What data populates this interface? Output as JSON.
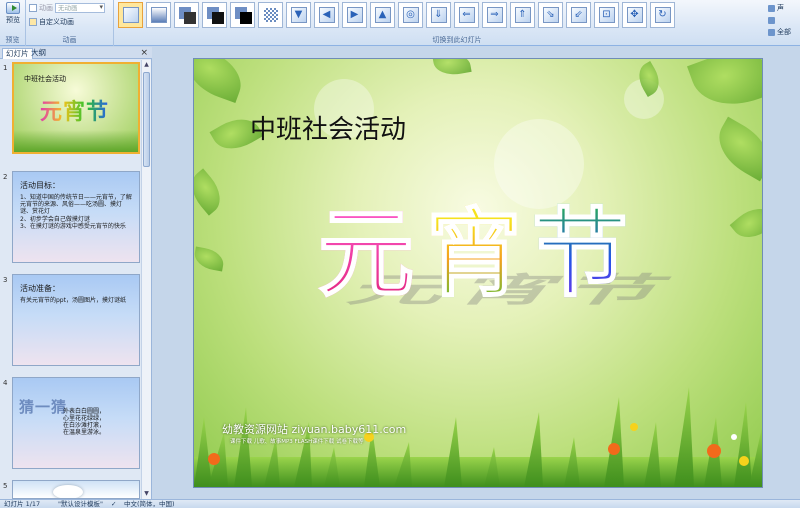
{
  "ribbon": {
    "preview_label": "预览",
    "preview_group": "预览",
    "anim_label": "动画",
    "anim_value": "无动画",
    "custom_anim_label": "自定义动画",
    "anim_group": "动画",
    "transition_group": "切换到此幻灯片",
    "sound_label": "声",
    "apply_all_label": "全部",
    "transitions": [
      "blank",
      "fade",
      "push-shadow",
      "cover",
      "dark-cut",
      "dissolve",
      "wipe-down",
      "wipe-left",
      "wipe-right",
      "wipe-up",
      "shape-in",
      "split-down",
      "split-left",
      "split-right",
      "box-up",
      "diagonal-right",
      "diagonal-left",
      "box-in",
      "box-out",
      "random"
    ]
  },
  "panel": {
    "tab_slides": "幻灯片",
    "tab_outline": "大纲",
    "close": "×"
  },
  "slides": [
    {
      "num": "1",
      "title": "中班社会活动",
      "big": "元宵节"
    },
    {
      "num": "2",
      "title": "活动目标：",
      "lines": [
        "1、知道中国的传统节日——元宵节，了解元宵节的来源、风俗——吃汤圆、摸灯谜、赏花灯",
        "2、初步学会自己做摸灯谜",
        "3、在摸灯谜的游戏中感受元宵节的快乐"
      ]
    },
    {
      "num": "3",
      "title": "活动准备：",
      "lines": [
        "有关元宵节的ppt，汤圆图片，摸灯谜纸"
      ]
    },
    {
      "num": "4",
      "title": "猜一猜",
      "lines": [
        "外表白白圆圆，",
        "心里花花绿绿，",
        "在白沙滩打滚，",
        "在温泉里游泳。"
      ]
    },
    {
      "num": "5"
    }
  ],
  "main_slide": {
    "title": "中班社会活动",
    "chars": [
      "元",
      "宵",
      "节"
    ],
    "footer_line1": "幼教资源网站  ziyuan.baby611.com",
    "footer_line2": "课件下载    儿歌、故事MP3    FLASH课件下载    试卷下载等"
  },
  "status": {
    "slide_pos": "幻灯片 1/17",
    "theme": "\"默认设计模板\"",
    "language": "中文(简体，中国)"
  },
  "colors": {
    "ribbon_border": "#8db2e3",
    "selection": "#f0b032",
    "workspace": "#c5d6ea"
  }
}
